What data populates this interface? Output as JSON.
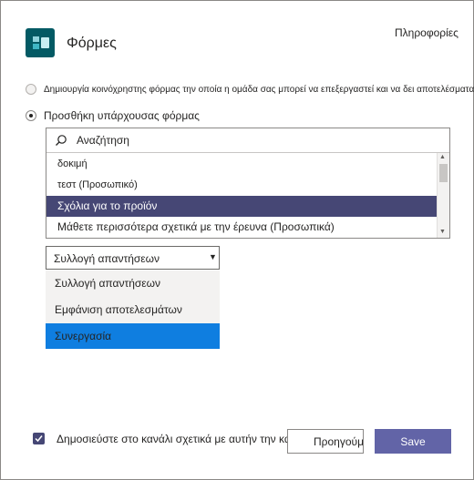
{
  "app": {
    "title": "Φόρμες",
    "about": "Πληροφορίες"
  },
  "options": {
    "create_new": "Δημιουργία κοινόχρηστης φόρμας την οποία η ομάδα σας μπορεί να επεξεργαστεί και να δει αποτελέσματα",
    "add_existing": "Προσθήκη υπάρχουσας φόρμας",
    "selected": "add_existing"
  },
  "search": {
    "value": "Αναζήτηση"
  },
  "forms": [
    {
      "label": "δοκιμή",
      "selected": false
    },
    {
      "label": "τεστ (Προσωπικό)",
      "selected": false
    },
    {
      "label": "Σχόλια για το προϊόν",
      "selected": true
    },
    {
      "label": "Μάθετε περισσότερα σχετικά με την έρευνα (Προσωπικά)",
      "selected": false
    }
  ],
  "mode_dropdown": {
    "value": "Συλλογή απαντήσεων",
    "options": [
      "Συλλογή απαντήσεων",
      "Εμφάνιση αποτελεσμάτων",
      "Συνεργασία"
    ],
    "highlighted": "Συνεργασία"
  },
  "footer": {
    "post_to_channel": "Δημοσιεύστε στο κανάλι σχετικά με αυτήν την καρτέλα",
    "post_checked": true,
    "back_label": "Προηγούμενο",
    "save_label": "Save"
  },
  "colors": {
    "accent": "#6264a7",
    "selected_row": "#464775",
    "highlight_option": "#0f7ee0",
    "app_icon": "#035a64"
  }
}
